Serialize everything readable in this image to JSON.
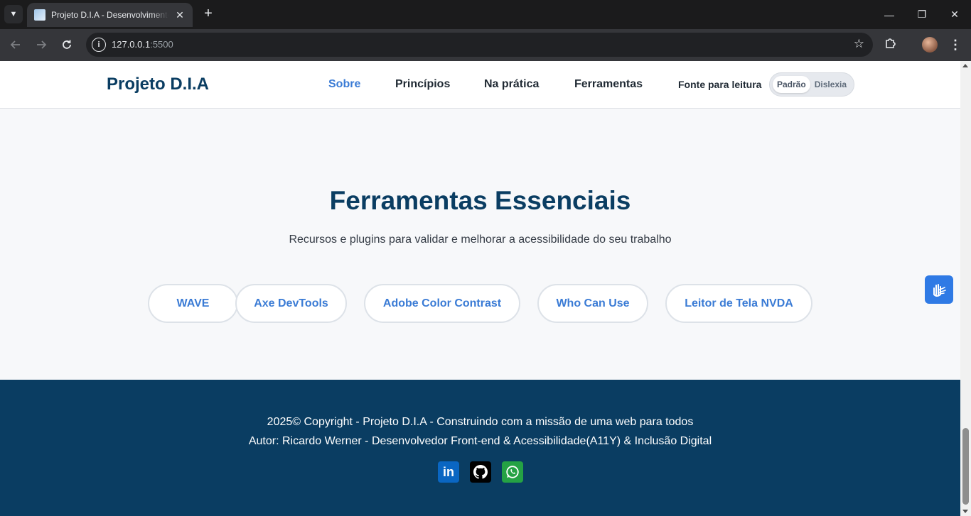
{
  "browser": {
    "tab_title": "Projeto D.I.A - Desenvolvimento",
    "tab_close": "✕",
    "new_tab": "+",
    "url_host": "127.0.0.1",
    "url_port": ":5500",
    "window_controls": {
      "minimize": "—",
      "restore": "❐",
      "close": "✕"
    }
  },
  "header": {
    "brand": "Projeto D.I.A",
    "nav": [
      "Sobre",
      "Princípios",
      "Na prática",
      "Ferramentas"
    ],
    "active_nav": "Sobre",
    "font_label": "Fonte para leitura",
    "font_options": [
      "Padrão",
      "Dislexia"
    ],
    "font_selected": "Padrão"
  },
  "tools": {
    "title": "Ferramentas Essenciais",
    "subtitle": "Recursos e plugins para validar e melhorar a acessibilidade do seu trabalho",
    "buttons": [
      "WAVE",
      "Axe DevTools",
      "Adobe Color Contrast",
      "Who Can Use",
      "Leitor de Tela NVDA"
    ]
  },
  "footer": {
    "line1": "2025© Copyright - Projeto D.I.A - Construindo com a missão de uma web para todos",
    "line2": "Autor: Ricardo Werner - Desenvolvedor Front-end & Acessibilidade(A11Y) & Inclusão Digital",
    "social": [
      {
        "icon": "linkedin-icon",
        "text": "in",
        "color": "#0a66c2"
      },
      {
        "icon": "github-icon",
        "color": "#000000"
      },
      {
        "icon": "whatsapp-icon",
        "color": "#25a244"
      }
    ]
  },
  "colors": {
    "primary": "#0a3d62",
    "accent": "#3a7bd5",
    "vlibras": "#2f7ae5"
  }
}
